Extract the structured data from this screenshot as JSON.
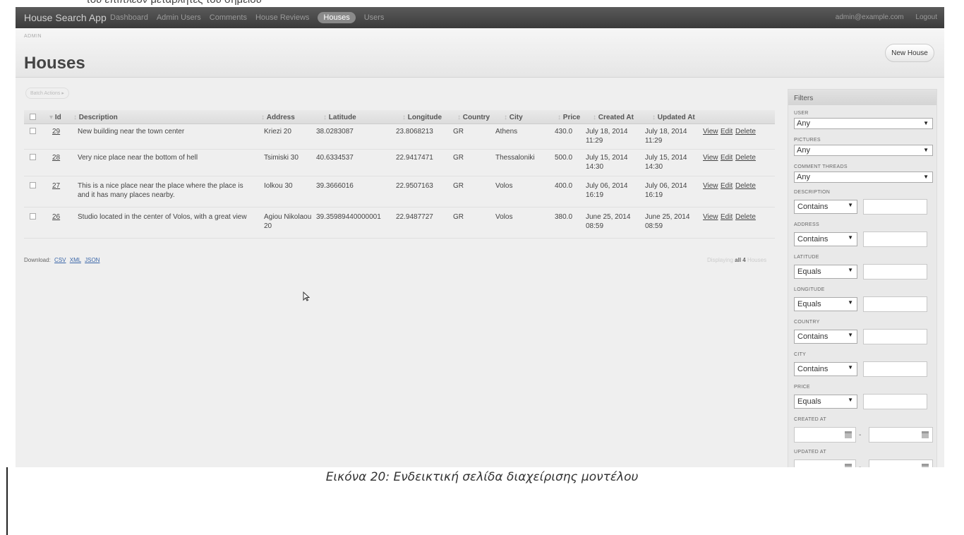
{
  "top_cut_text": "του επιπλέον μεταβλητές του σημείου",
  "nav": {
    "brand": "House Search App",
    "items": [
      "Dashboard",
      "Admin Users",
      "Comments",
      "House Reviews",
      "Houses",
      "Users"
    ],
    "active_index": 4,
    "user_email": "admin@example.com",
    "logout": "Logout"
  },
  "header": {
    "breadcrumb": "ADMIN",
    "title": "Houses",
    "new_button": "New House"
  },
  "batch_actions": "Batch Actions",
  "table": {
    "columns": [
      "",
      "Id",
      "Description",
      "Address",
      "Latitude",
      "Longitude",
      "Country",
      "City",
      "Price",
      "Created At",
      "Updated At",
      ""
    ],
    "rows": [
      {
        "id": "29",
        "description": "New building near the town center",
        "address": "Kriezi 20",
        "latitude": "38.0283087",
        "longitude": "23.8068213",
        "country": "GR",
        "city": "Athens",
        "price": "430.0",
        "created": "July 18, 2014 11:29",
        "updated": "July 18, 2014 11:29"
      },
      {
        "id": "28",
        "description": "Very nice place near the bottom of hell",
        "address": "Tsimiski 30",
        "latitude": "40.6334537",
        "longitude": "22.9417471",
        "country": "GR",
        "city": "Thessaloniki",
        "price": "500.0",
        "created": "July 15, 2014 14:30",
        "updated": "July 15, 2014 14:30"
      },
      {
        "id": "27",
        "description": "This is a nice place near the place where the place is and it has many places nearby.",
        "address": "Iolkou 30",
        "latitude": "39.3666016",
        "longitude": "22.9507163",
        "country": "GR",
        "city": "Volos",
        "price": "400.0",
        "created": "July 06, 2014 16:19",
        "updated": "July 06, 2014 16:19"
      },
      {
        "id": "26",
        "description": "Studio located in the center of Volos, with a great view",
        "address": "Agiou Nikolaou 20",
        "latitude": "39.35989440000001",
        "longitude": "22.9487727",
        "country": "GR",
        "city": "Volos",
        "price": "380.0",
        "created": "June 25, 2014 08:59",
        "updated": "June 25, 2014 08:59"
      }
    ],
    "actions": [
      "View",
      "Edit",
      "Delete"
    ]
  },
  "download": {
    "label": "Download:",
    "formats": [
      "CSV",
      "XML",
      "JSON"
    ]
  },
  "pagination": {
    "prefix": "Displaying",
    "count": "all 4",
    "suffix": "Houses"
  },
  "filters": {
    "title": "Filters",
    "select_filters": [
      {
        "label": "USER",
        "value": "Any"
      },
      {
        "label": "PICTURES",
        "value": "Any"
      },
      {
        "label": "COMMENT THREADS",
        "value": "Any"
      }
    ],
    "text_filters": [
      {
        "label": "DESCRIPTION",
        "operator": "Contains"
      },
      {
        "label": "ADDRESS",
        "operator": "Contains"
      },
      {
        "label": "LATITUDE",
        "operator": "Equals"
      },
      {
        "label": "LONGITUDE",
        "operator": "Equals"
      },
      {
        "label": "COUNTRY",
        "operator": "Contains"
      },
      {
        "label": "CITY",
        "operator": "Contains"
      },
      {
        "label": "PRICE",
        "operator": "Equals"
      }
    ],
    "date_filters": [
      {
        "label": "CREATED AT"
      },
      {
        "label": "UPDATED AT"
      }
    ],
    "date_separator": "-"
  },
  "caption": "Εικόνα 20: Ενδεικτική σελίδα διαχείρισης μοντέλου"
}
